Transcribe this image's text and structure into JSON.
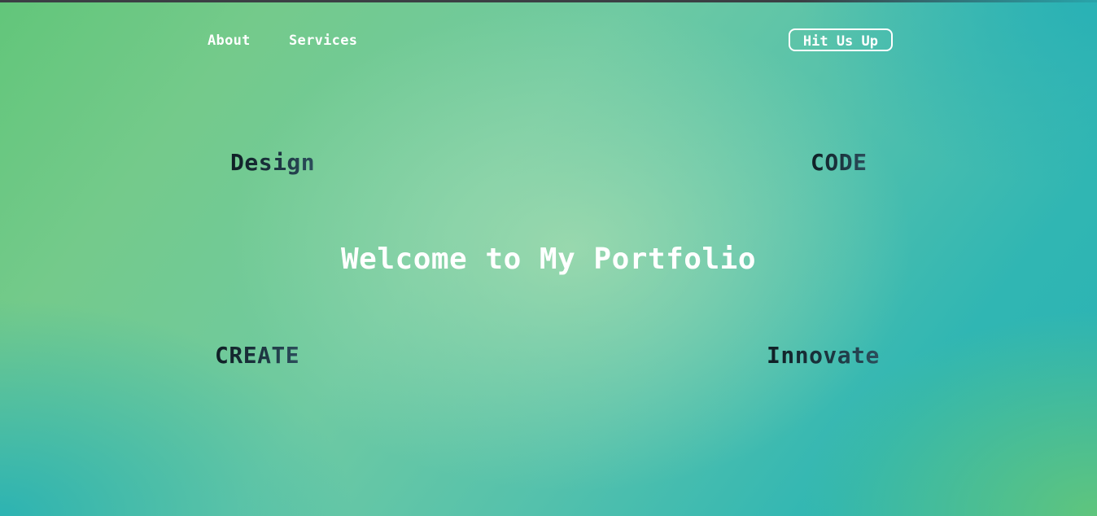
{
  "nav": {
    "about_label": "About",
    "services_label": "Services",
    "cta_label": "Hit Us Up"
  },
  "hero": {
    "title": "Welcome to My Portfolio"
  },
  "floating_words": {
    "design": "Design",
    "code": "CODE",
    "create": "CREATE",
    "innovate": "Innovate"
  },
  "colors": {
    "gradient_green": "#62c67a",
    "gradient_teal": "#2bb2b4",
    "hero_center": "#aadeb0",
    "text_light": "#ffffff",
    "text_dark": "#0f1e24"
  }
}
